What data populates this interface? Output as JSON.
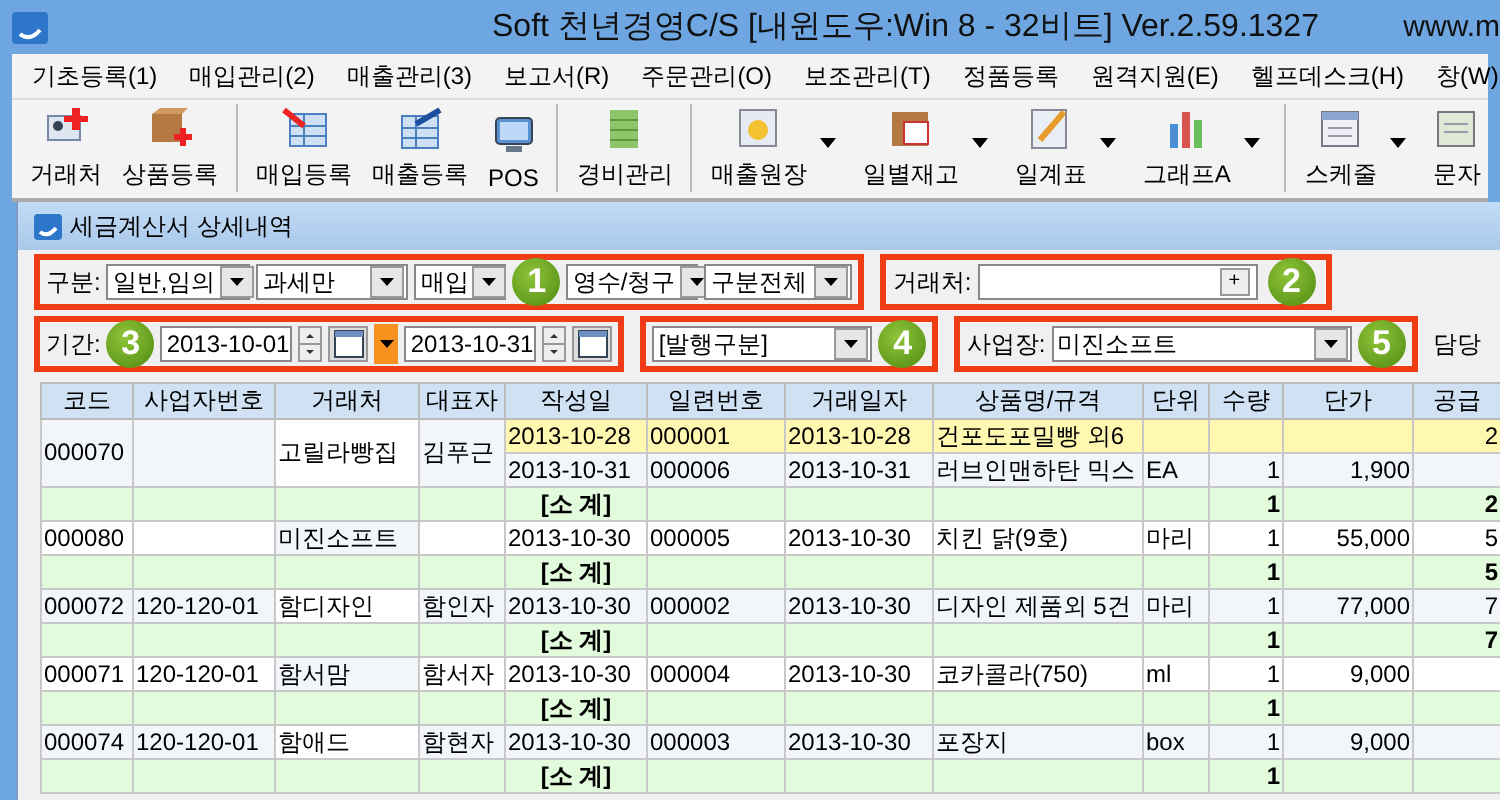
{
  "window": {
    "title": "Soft 천년경영C/S [내윈도우:Win 8 - 32비트] Ver.2.59.1327",
    "url": "www.m"
  },
  "menu": [
    "기초등록(1)",
    "매입관리(2)",
    "매출관리(3)",
    "보고서(R)",
    "주문관리(O)",
    "보조관리(T)",
    "정품등록",
    "원격지원(E)",
    "헬프데스크(H)",
    "창(W)"
  ],
  "toolbar": [
    {
      "label": "거래처",
      "dropdown": false,
      "group_start": false
    },
    {
      "label": "상품등록",
      "dropdown": false,
      "group_start": false
    },
    {
      "label": "매입등록",
      "dropdown": false,
      "group_start": true
    },
    {
      "label": "매출등록",
      "dropdown": false,
      "group_start": false
    },
    {
      "label": "POS",
      "dropdown": false,
      "group_start": false
    },
    {
      "label": "경비관리",
      "dropdown": false,
      "group_start": true
    },
    {
      "label": "매출원장",
      "dropdown": true,
      "group_start": true
    },
    {
      "label": "일별재고",
      "dropdown": true,
      "group_start": false
    },
    {
      "label": "일계표",
      "dropdown": true,
      "group_start": false
    },
    {
      "label": "그래프A",
      "dropdown": true,
      "group_start": false
    },
    {
      "label": "스케줄",
      "dropdown": true,
      "group_start": true
    },
    {
      "label": "문자",
      "dropdown": false,
      "group_start": false
    }
  ],
  "subwindow": {
    "title": "세금계산서 상세내역"
  },
  "filters": {
    "category_label": "구분:",
    "selects": [
      "일반,임의",
      "과세만",
      "매입",
      "영수/청구",
      "구분전체"
    ],
    "partner_label": "거래처:",
    "partner_button": "+",
    "period_label": "기간:",
    "date_from": "2013-10-01",
    "date_to": "2013-10-31",
    "issue_select": "[발행구분]",
    "site_label": "사업장:",
    "site_select": "미진소프트",
    "manager_label": "담당"
  },
  "badges": [
    "1",
    "2",
    "3",
    "4",
    "5"
  ],
  "table": {
    "columns": [
      "코드",
      "사업자번호",
      "거래처",
      "대표자",
      "작성일",
      "일련번호",
      "거래일자",
      "상품명/규격",
      "단위",
      "수량",
      "단가",
      "공급"
    ],
    "groups": [
      {
        "code": "000070",
        "partner": "고릴라빵집",
        "rep": "김푸근",
        "items": [
          {
            "date": "2013-10-28",
            "serial": "000001",
            "trade_date": "2013-10-28",
            "product": "건포도포밀빵 외6",
            "supply": "2",
            "selected": true
          },
          {
            "date": "2013-10-31",
            "serial": "000006",
            "trade_date": "2013-10-31",
            "product": "러브인맨하탄 믹스",
            "unit": "EA",
            "qty": "1",
            "price": "1,900",
            "selected": false
          }
        ],
        "subtotal": {
          "label": "[소 계]",
          "qty": "1",
          "supply": "2"
        }
      },
      {
        "code": "000080",
        "partner": "미진소프트",
        "items": [
          {
            "date": "2013-10-30",
            "serial": "000005",
            "trade_date": "2013-10-30",
            "product": "치킨 닭(9호)",
            "unit": "마리",
            "qty": "1",
            "price": "55,000",
            "supply": "5",
            "selected": false
          }
        ],
        "subtotal": {
          "label": "[소 계]",
          "qty": "1",
          "supply": "5"
        }
      },
      {
        "code": "000072",
        "biz_no": "120-120-01",
        "partner": "함디자인",
        "rep": "함인자",
        "items": [
          {
            "date": "2013-10-30",
            "serial": "000002",
            "trade_date": "2013-10-30",
            "product": "디자인 제품외 5건",
            "unit": "마리",
            "qty": "1",
            "price": "77,000",
            "supply": "7",
            "selected": false
          }
        ],
        "subtotal": {
          "label": "[소 계]",
          "qty": "1",
          "supply": "7"
        }
      },
      {
        "code": "000071",
        "biz_no": "120-120-01",
        "partner": "함서맘",
        "rep": "함서자",
        "items": [
          {
            "date": "2013-10-30",
            "serial": "000004",
            "trade_date": "2013-10-30",
            "product": "코카콜라(750)",
            "unit": "ml",
            "qty": "1",
            "price": "9,000",
            "selected": false
          }
        ],
        "subtotal": {
          "label": "[소 계]",
          "qty": "1"
        }
      },
      {
        "code": "000074",
        "biz_no": "120-120-01",
        "partner": "함애드",
        "rep": "함현자",
        "items": [
          {
            "date": "2013-10-30",
            "serial": "000003",
            "trade_date": "2013-10-30",
            "product": "포장지",
            "unit": "box",
            "qty": "1",
            "price": "9,000",
            "selected": false
          }
        ],
        "subtotal": {
          "label": "[소 계]",
          "qty": "1"
        }
      }
    ]
  }
}
